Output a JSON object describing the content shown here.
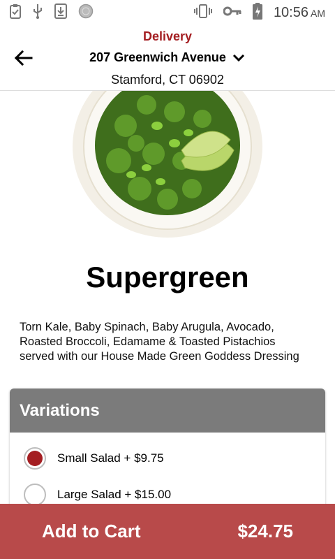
{
  "status_bar": {
    "time": "10:56",
    "ampm": "AM",
    "icons": [
      "clipboard-check-icon",
      "usb-icon",
      "download-icon",
      "globe-icon",
      "vibrate-icon",
      "key-icon",
      "battery-charging-icon"
    ]
  },
  "header": {
    "mode": "Delivery",
    "address": "207 Greenwich Avenue",
    "city": "Stamford, CT 06902"
  },
  "product": {
    "name": "Supergreen",
    "description": "Torn Kale, Baby Spinach, Baby Arugula, Avocado, Roasted Broccoli, Edamame & Toasted Pistachios served with our House Made Green Goddess Dressing"
  },
  "variations": {
    "heading": "Variations",
    "options": [
      {
        "label": "Small Salad + $9.75",
        "selected": true
      },
      {
        "label": "Large Salad + $15.00",
        "selected": false
      }
    ]
  },
  "cart": {
    "button_label": "Add to Cart",
    "total": "$24.75"
  },
  "colors": {
    "accent": "#a41e22",
    "cart_bar": "#b84a4a",
    "variation_header": "#7b7b7b"
  }
}
